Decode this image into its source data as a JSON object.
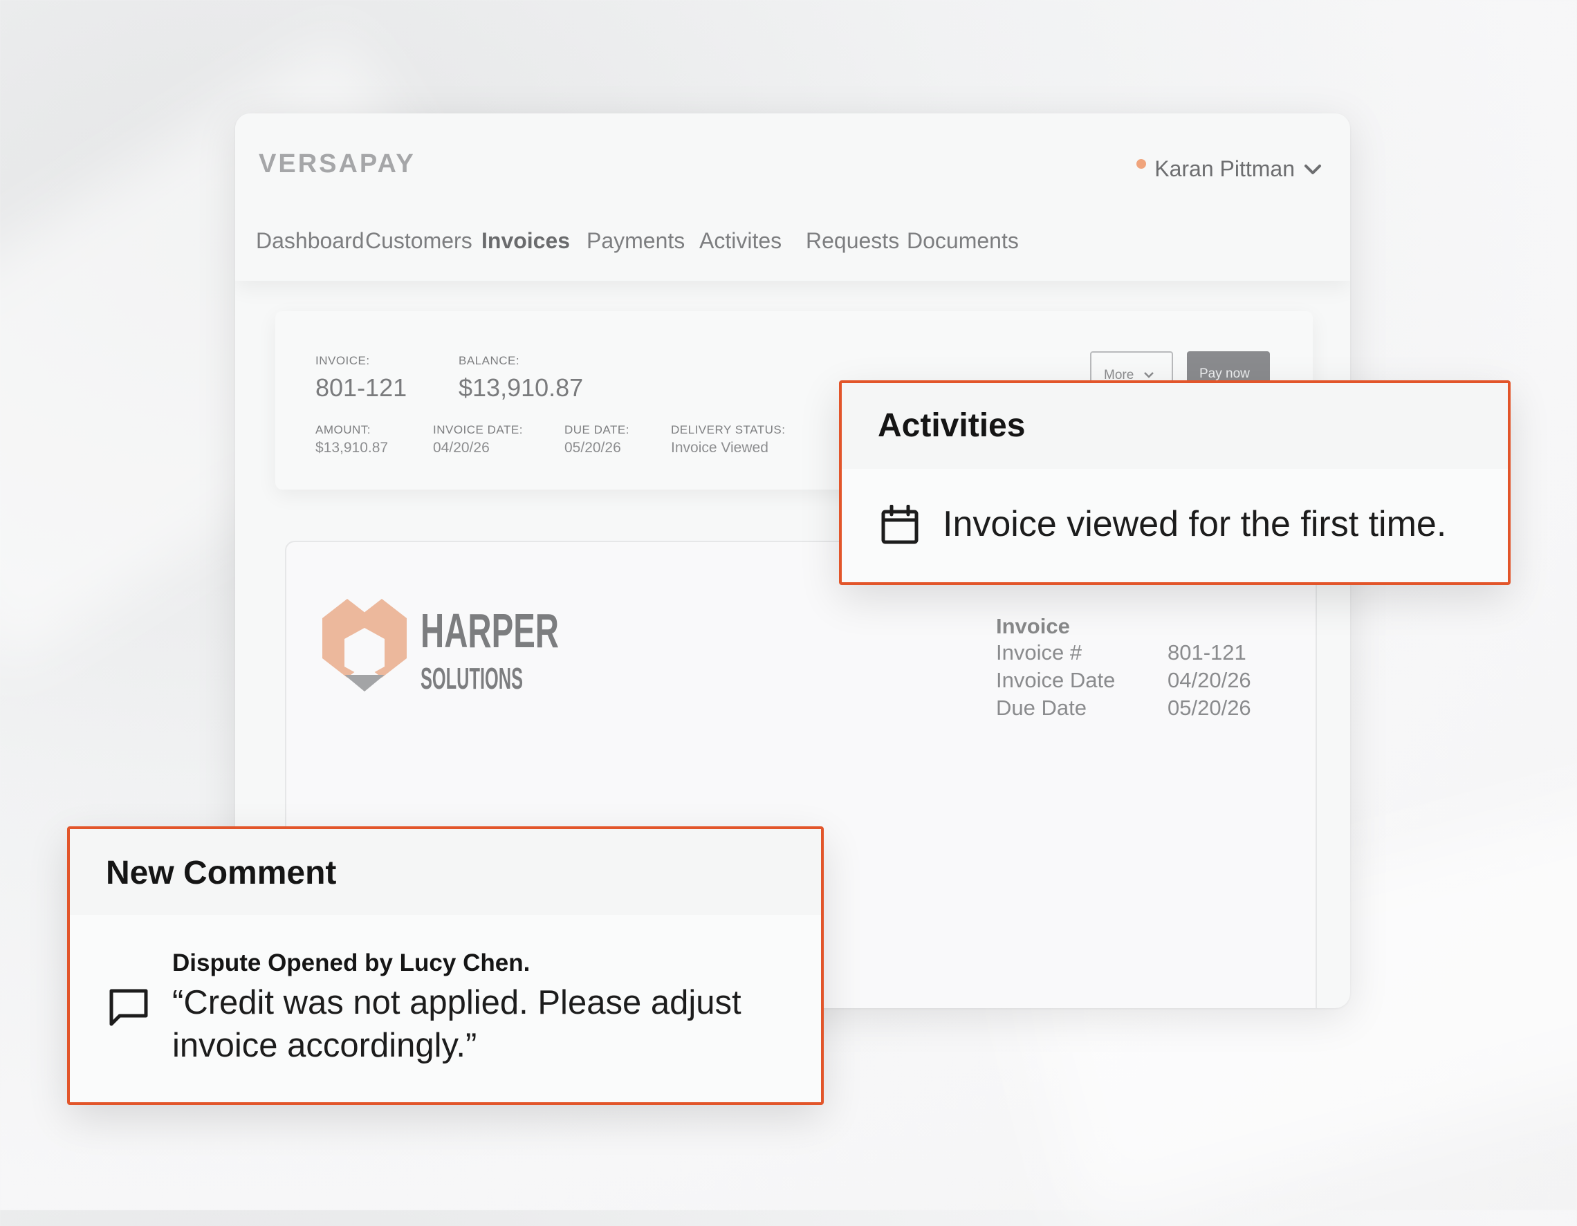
{
  "app": {
    "brand": "VERSAPAY",
    "user_name": "Karan Pittman"
  },
  "nav": [
    "Dashboard",
    "Customers",
    "Invoices",
    "Payments",
    "Activites",
    "Requests",
    "Documents"
  ],
  "summary": {
    "invoice_label": "INVOICE:",
    "invoice_value": "801-121",
    "balance_label": "BALANCE:",
    "balance_value": "$13,910.87",
    "amount_label": "AMOUNT:",
    "amount_value": "$13,910.87",
    "invoice_date_label": "INVOICE DATE:",
    "invoice_date_value": "04/20/26",
    "due_date_label": "DUE DATE:",
    "due_date_value": "05/20/26",
    "delivery_label": "DELIVERY STATUS:",
    "delivery_value": "Invoice Viewed",
    "more_label": "More",
    "pay_label": "Pay now"
  },
  "document": {
    "company_line1": "HARPER",
    "company_line2": "SOLUTIONS",
    "title": "Invoice",
    "rows": [
      {
        "label": "Invoice #",
        "value": "801-121"
      },
      {
        "label": "Invoice Date",
        "value": "04/20/26"
      },
      {
        "label": "Due Date",
        "value": "05/20/26"
      }
    ]
  },
  "activities": {
    "title": "Activities",
    "text": "Invoice viewed for the first time."
  },
  "comment": {
    "title": "New Comment",
    "author_line": "Dispute Opened by Lucy Chen.",
    "text": "“Credit was not applied. Please adjust invoice accordingly.”"
  },
  "colors": {
    "accent": "#e2552a",
    "logo_peach": "#ecb89c",
    "status_dot": "#f0a47c"
  }
}
